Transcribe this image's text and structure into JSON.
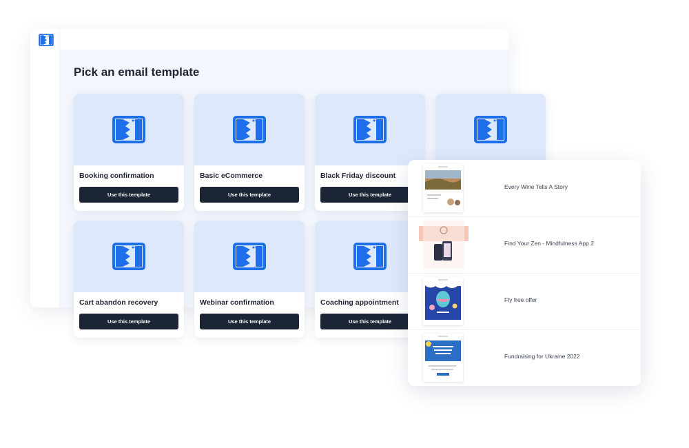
{
  "app": {
    "logo": "clickfunnels-logo-icon"
  },
  "page": {
    "title": "Pick an email template"
  },
  "templates": [
    {
      "name": "Booking confirmation",
      "button": "Use this template"
    },
    {
      "name": "Basic eCommerce",
      "button": "Use this template"
    },
    {
      "name": "Black Friday discount",
      "button": "Use this template"
    },
    {
      "name": "Cart abandon recovery",
      "button": "Use this template"
    },
    {
      "name": "Webinar confirmation",
      "button": "Use this template"
    },
    {
      "name": "Coaching appointment",
      "button": "Use this template"
    }
  ],
  "template_list": [
    {
      "name": "Every Wine Tells A Story"
    },
    {
      "name": "Find Your Zen - Mindfulness App 2"
    },
    {
      "name": "Fly free offer"
    },
    {
      "name": "Fundraising for Ukraine 2022"
    }
  ],
  "colors": {
    "brand_blue": "#1f6feb",
    "button_dark": "#1b2536",
    "thumb_bg": "#dde9fb",
    "page_bg": "#f3f7fd"
  }
}
